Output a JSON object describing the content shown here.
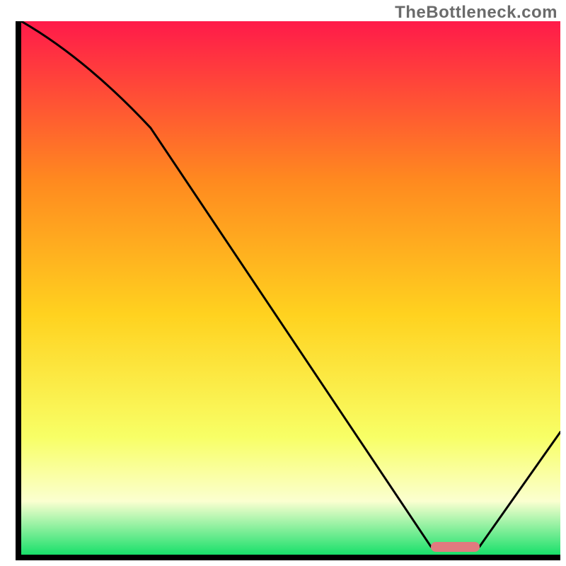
{
  "watermark": "TheBottleneck.com",
  "colors": {
    "gradient_top": "#ff1a4a",
    "gradient_mid_upper": "#ff8a1f",
    "gradient_mid": "#ffd21f",
    "gradient_lower": "#f8ff66",
    "gradient_pale": "#fbffd0",
    "gradient_bottom": "#18e06a",
    "axis": "#000000",
    "curve": "#000000",
    "marker": "#e17a7f"
  },
  "chart_data": {
    "type": "line",
    "title": "",
    "xlabel": "",
    "ylabel": "",
    "xlim": [
      0,
      100
    ],
    "ylim": [
      0,
      100
    ],
    "grid": false,
    "legend": false,
    "annotations": [
      {
        "kind": "marker-bar",
        "x_start": 76,
        "x_end": 85,
        "y": 1.5
      }
    ],
    "series": [
      {
        "name": "bottleneck-curve",
        "x": [
          0,
          24,
          76,
          85,
          100
        ],
        "y": [
          100,
          80,
          1.5,
          1.5,
          23
        ]
      }
    ],
    "background_gradient_stops": [
      {
        "pos": 0.0,
        "color": "#ff1a4a"
      },
      {
        "pos": 0.3,
        "color": "#ff8a1f"
      },
      {
        "pos": 0.55,
        "color": "#ffd21f"
      },
      {
        "pos": 0.78,
        "color": "#f8ff66"
      },
      {
        "pos": 0.9,
        "color": "#fbffd0"
      },
      {
        "pos": 1.0,
        "color": "#18e06a"
      }
    ]
  }
}
